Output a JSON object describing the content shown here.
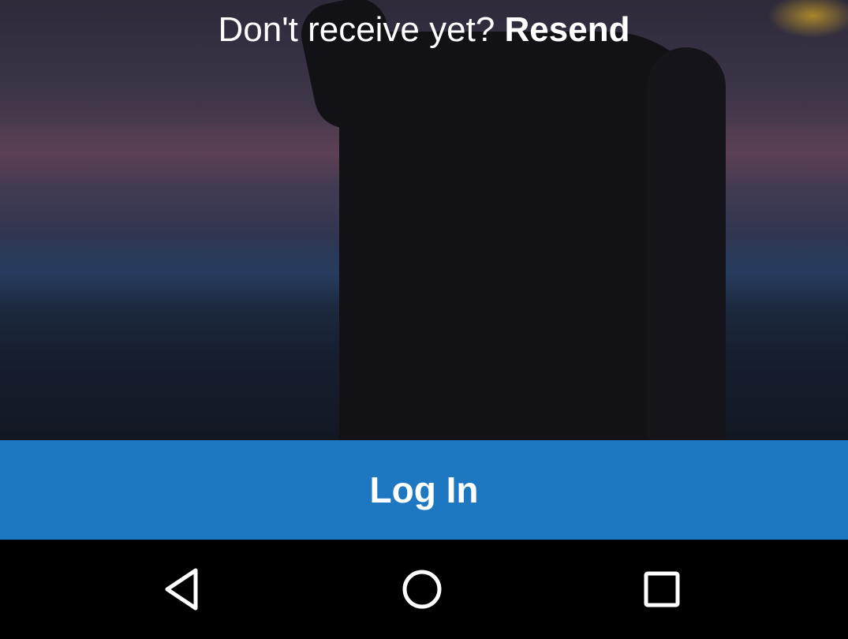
{
  "verify": {
    "prompt_text": "Don't receive yet?",
    "resend_label": "Resend"
  },
  "login": {
    "button_label": "Log In"
  },
  "colors": {
    "login_button": "#1e78c1",
    "navbar": "#000000",
    "text": "#ffffff"
  },
  "navbar": {
    "icons": [
      "back-icon",
      "home-icon",
      "recents-icon"
    ]
  }
}
